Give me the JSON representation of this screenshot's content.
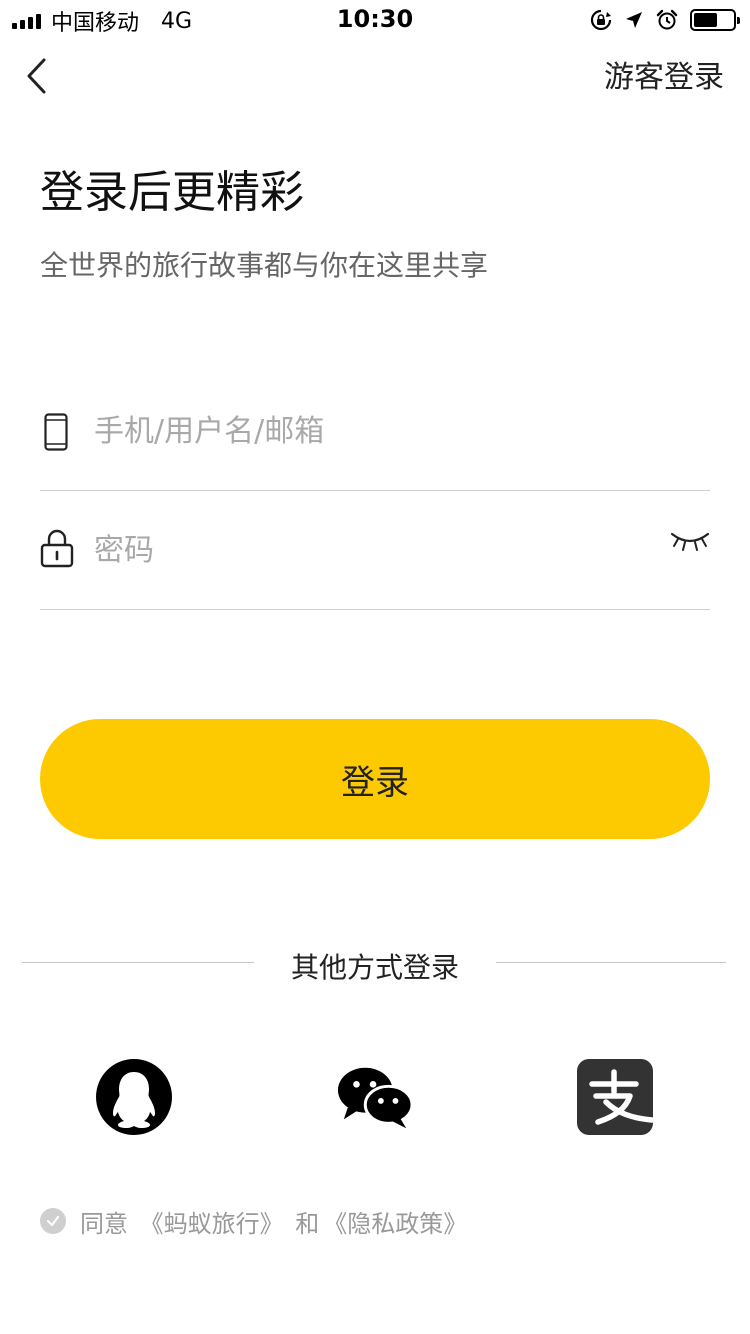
{
  "status_bar": {
    "carrier": "中国移动",
    "network": "4G",
    "time": "10:30",
    "battery_level": 0.6
  },
  "nav": {
    "back_icon": "chevron-left-icon",
    "guest_login": "游客登录"
  },
  "header": {
    "title": "登录后更精彩",
    "subtitle": "全世界的旅行故事都与你在这里共享"
  },
  "form": {
    "account_placeholder": "手机/用户名/邮箱",
    "account_value": "",
    "password_placeholder": "密码",
    "password_value": "",
    "account_icon": "phone-icon",
    "password_icon": "lock-icon",
    "toggle_icon": "eye-closed-icon"
  },
  "login_button": "登录",
  "other_login": {
    "label": "其他方式登录",
    "methods": [
      "qq-icon",
      "wechat-icon",
      "alipay-icon"
    ]
  },
  "agreement": {
    "prefix": "同意",
    "terms": "《蚂蚁旅行》",
    "joiner": "和",
    "privacy": "《隐私政策》"
  },
  "colors": {
    "accent": "#fdca01",
    "placeholder": "#a9a9a9",
    "divider": "#cfcfcf"
  }
}
